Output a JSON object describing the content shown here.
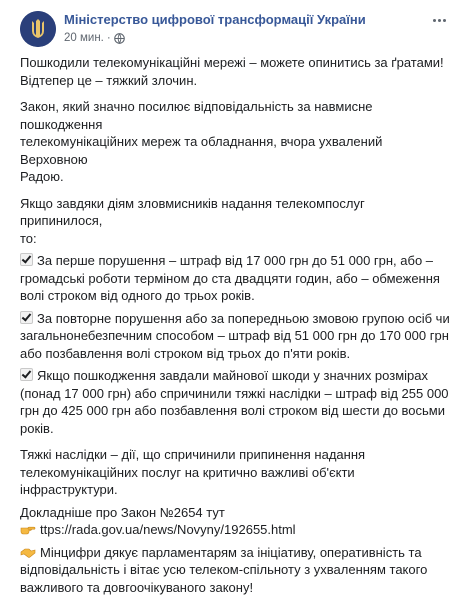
{
  "post": {
    "page_name": "Міністерство цифрової трансформації України",
    "time": "20 мин.",
    "separator": "·"
  },
  "icons": {
    "avatar": "trident-emblem-icon",
    "privacy": "globe-icon",
    "more": "more-options-icon",
    "check": "check-mark-icon",
    "pointing_hand": "pointing-hand-icon",
    "handshake": "handshake-icon"
  },
  "colors": {
    "page_name": "#385898",
    "avatar_bg": "#2a3f7a",
    "text": "#1c1e21",
    "meta": "#606770"
  },
  "content": {
    "p1_l1": "Пошкодили телекомунікаційні мережі – можете опинитись за ґратами!",
    "p1_l2": "Відтепер це – тяжкий злочин.",
    "p2_l1": "Закон, який значно посилює відповідальність за навмисне пошкодження",
    "p2_l2": "телекомунікаційних мереж та обладнання, вчора ухвалений Верховною",
    "p2_l3": "Радою.",
    "p3_l1": "Якщо завдяки діям зловмисників надання телекомпослуг припинилося,",
    "p3_l2": "то:",
    "b1_l1": "За перше порушення – штраф від 17 000 грн до 51 000 грн, або –",
    "b1_l2": "громадські роботи терміном до ста двадцяти годин, або – обмеження",
    "b1_l3": "волі строком від одного до трьох років.",
    "b2_l1": "За повторне порушення або за попередньою змовою групою осіб чи",
    "b2_l2": "загальнонебезпечним способом – штраф від 51 000 грн до 170 000 грн",
    "b2_l3": "або позбавлення волі строком від трьох до п'яти років.",
    "b3_l1": "Якщо пошкодження завдали майнової шкоди у значних розмірах",
    "b3_l2": "(понад 17 000 грн) або спричинили тяжкі наслідки – штраф від 255 000",
    "b3_l3": "грн до 425 000 грн або позбавлення волі строком від шести до восьми",
    "b3_l4": "років.",
    "p4_l1": "Тяжкі наслідки – дії, що спричинили припинення надання",
    "p4_l2": "телекомунікаційних послуг на критично важливі об'єкти інфраструктури.",
    "p5_l1": "Докладніше про Закон №2654 тут",
    "p5_link": "ttps://rada.gov.ua/news/Novyny/192655.html",
    "p6_l1": "Мінцифри дякує парламентарям за ініціативу, оперативність та",
    "p6_l2": "відповідальність і вітає усю телеком-спільноту з ухваленням такого",
    "p6_l3": "важливого та довгоочікуваного закону!"
  }
}
